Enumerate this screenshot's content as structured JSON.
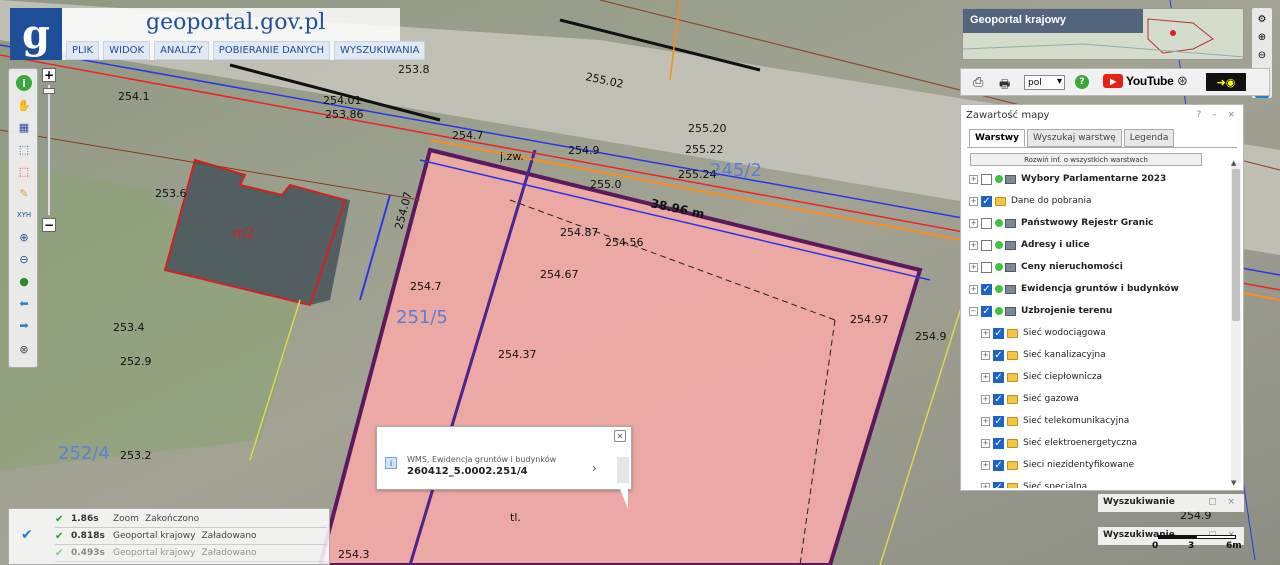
{
  "header": {
    "logo_letter": "g",
    "site_title": "geoportal.gov.pl",
    "menu": [
      "PLIK",
      "WIDOK",
      "ANALIZY",
      "POBIERANIE DANYCH",
      "WYSZUKIWANIA"
    ]
  },
  "map": {
    "labels": [
      {
        "text": "253.8"
      },
      {
        "text": "254.1"
      },
      {
        "text": "254.01"
      },
      {
        "text": "253.86"
      },
      {
        "text": "253.6"
      },
      {
        "text": "253.4"
      },
      {
        "text": "252.9"
      },
      {
        "text": "253.2"
      },
      {
        "text": "m2"
      },
      {
        "text": "254.7"
      },
      {
        "text": "255.0"
      },
      {
        "text": "254.9"
      },
      {
        "text": "254.87"
      },
      {
        "text": "254.56"
      },
      {
        "text": "254.67"
      },
      {
        "text": "254.97"
      },
      {
        "text": "254.7"
      },
      {
        "text": "254.37"
      },
      {
        "text": "254.07"
      },
      {
        "text": "254.3"
      },
      {
        "text": "251/5"
      },
      {
        "text": "245/2"
      },
      {
        "text": "38.96 m"
      },
      {
        "text": "255.22"
      },
      {
        "text": "255.24"
      },
      {
        "text": "255.20"
      },
      {
        "text": "255.02"
      },
      {
        "text": "254.9"
      },
      {
        "text": "254.9"
      },
      {
        "text": "j.zw."
      },
      {
        "text": "tl."
      },
      {
        "text": "252/4"
      }
    ]
  },
  "minimap": {
    "label": "Geoportal krajowy"
  },
  "topbar": {
    "lang": "pol",
    "youtube": "YouTube"
  },
  "panel": {
    "title": "Zawartość mapy",
    "controls": "? – ×",
    "tabs": [
      "Warstwy",
      "Wyszukaj warstwę",
      "Legenda"
    ],
    "expand_button": "Rozwiń inf. o wszystkich warstwach",
    "layers": [
      {
        "label": "Wybory Parlamentarne 2023",
        "bold": true,
        "checked": false,
        "indent": 0,
        "type": "wms"
      },
      {
        "label": "Dane do pobrania",
        "bold": false,
        "checked": true,
        "indent": 0,
        "type": "folder"
      },
      {
        "label": "Państwowy Rejestr Granic",
        "bold": true,
        "checked": false,
        "indent": 0,
        "type": "wms"
      },
      {
        "label": "Adresy i ulice",
        "bold": true,
        "checked": false,
        "indent": 0,
        "type": "wms"
      },
      {
        "label": "Ceny nieruchomości",
        "bold": true,
        "checked": false,
        "indent": 0,
        "type": "wms"
      },
      {
        "label": "Ewidencja gruntów i budynków",
        "bold": true,
        "checked": true,
        "indent": 0,
        "type": "wms"
      },
      {
        "label": "Uzbrojenie terenu",
        "bold": true,
        "checked": true,
        "indent": 0,
        "type": "wms",
        "expanded": true
      },
      {
        "label": "Sieć wodociągowa",
        "bold": false,
        "checked": true,
        "indent": 1,
        "type": "folder"
      },
      {
        "label": "Sieć kanalizacyjna",
        "bold": false,
        "checked": true,
        "indent": 1,
        "type": "folder"
      },
      {
        "label": "Sieć ciepłownicza",
        "bold": false,
        "checked": true,
        "indent": 1,
        "type": "folder"
      },
      {
        "label": "Sieć gazowa",
        "bold": false,
        "checked": true,
        "indent": 1,
        "type": "folder"
      },
      {
        "label": "Sieć telekomunikacyjna",
        "bold": false,
        "checked": true,
        "indent": 1,
        "type": "folder"
      },
      {
        "label": "Sieć elektroenergetyczna",
        "bold": false,
        "checked": true,
        "indent": 1,
        "type": "folder"
      },
      {
        "label": "Sieci niezidentyfikowane",
        "bold": false,
        "checked": true,
        "indent": 1,
        "type": "folder"
      },
      {
        "label": "Sieć specjalna",
        "bold": false,
        "checked": true,
        "indent": 1,
        "type": "folder"
      }
    ]
  },
  "popup": {
    "source": "WMS, Ewidencja gruntów i budynków",
    "id": "260412_5.0002.251/4"
  },
  "status": [
    {
      "time": "1.86s",
      "source": "Zoom",
      "state": "Zakończono"
    },
    {
      "time": "0.818s",
      "source": "Geoportal krajowy",
      "state": "Załadowano"
    },
    {
      "time": "0.493s",
      "source": "Geoportal krajowy",
      "state": "Załadowano"
    }
  ],
  "search_panels": [
    "Wyszukiwanie",
    "Wyszukiwanie"
  ],
  "scale": {
    "t0": "0",
    "t1": "3",
    "t2": "6m"
  },
  "colors": {
    "brand": "#1f4f99",
    "parcel_fill": "#f2a9a6",
    "parcel_border": "#5c1a5e"
  }
}
